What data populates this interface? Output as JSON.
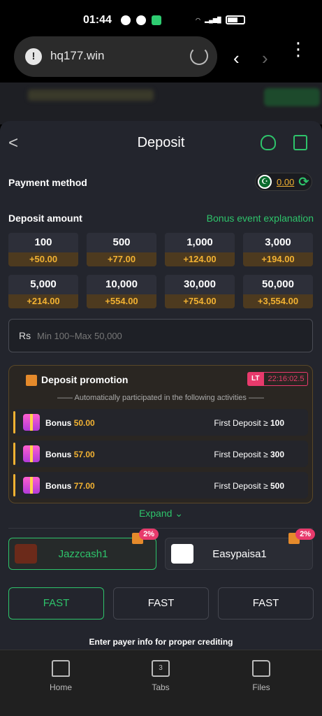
{
  "status": {
    "time": "01:44"
  },
  "browser": {
    "url": "hq177.win"
  },
  "header": {
    "title": "Deposit",
    "back": "<"
  },
  "payment": {
    "label": "Payment method",
    "balance": "0.00",
    "flag_mark": "☪"
  },
  "deposit": {
    "label": "Deposit amount",
    "bonus_link": "Bonus event explanation",
    "options": [
      {
        "amount": "100",
        "bonus": "+50.00"
      },
      {
        "amount": "500",
        "bonus": "+77.00"
      },
      {
        "amount": "1,000",
        "bonus": "+124.00"
      },
      {
        "amount": "3,000",
        "bonus": "+194.00"
      },
      {
        "amount": "5,000",
        "bonus": "+214.00"
      },
      {
        "amount": "10,000",
        "bonus": "+554.00"
      },
      {
        "amount": "30,000",
        "bonus": "+754.00"
      },
      {
        "amount": "50,000",
        "bonus": "+3,554.00"
      }
    ],
    "currency": "Rs",
    "placeholder": "Min 100~Max 50,000"
  },
  "promotion": {
    "title": "Deposit promotion",
    "lt_label": "LT",
    "timer": "22:16:02.5",
    "subtitle": "—— Automatically participated in the following activities ——",
    "items": [
      {
        "label": "Bonus",
        "value": "50.00",
        "cond": "First Deposit ≥",
        "cond_value": "100"
      },
      {
        "label": "Bonus",
        "value": "57.00",
        "cond": "First Deposit ≥",
        "cond_value": "300"
      },
      {
        "label": "Bonus",
        "value": "77.00",
        "cond": "First Deposit ≥",
        "cond_value": "500"
      }
    ],
    "expand": "Expand ⌄"
  },
  "channels": [
    {
      "name": "Jazzcash1",
      "badge": "2%"
    },
    {
      "name": "Easypaisa1",
      "badge": "2%"
    }
  ],
  "fast": [
    "FAST",
    "FAST",
    "FAST"
  ],
  "payer_note": "Enter payer info for proper crediting",
  "bottom_nav": [
    {
      "label": "Home",
      "icon": "home-icon"
    },
    {
      "label": "Tabs",
      "icon": "tabs-icon",
      "count": "3"
    },
    {
      "label": "Files",
      "icon": "folder-icon"
    }
  ],
  "colors": {
    "accent": "#2ec46b",
    "bonus": "#f2b232",
    "badge": "#e83a6c"
  }
}
